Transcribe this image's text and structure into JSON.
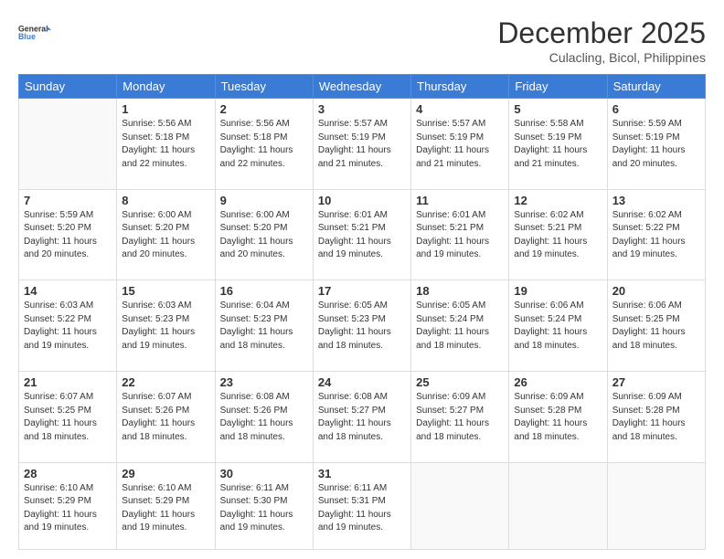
{
  "logo": {
    "line1": "General",
    "line2": "Blue"
  },
  "header": {
    "month_year": "December 2025",
    "location": "Culacling, Bicol, Philippines"
  },
  "weekdays": [
    "Sunday",
    "Monday",
    "Tuesday",
    "Wednesday",
    "Thursday",
    "Friday",
    "Saturday"
  ],
  "weeks": [
    [
      {
        "day": "",
        "info": ""
      },
      {
        "day": "1",
        "info": "Sunrise: 5:56 AM\nSunset: 5:18 PM\nDaylight: 11 hours\nand 22 minutes."
      },
      {
        "day": "2",
        "info": "Sunrise: 5:56 AM\nSunset: 5:18 PM\nDaylight: 11 hours\nand 22 minutes."
      },
      {
        "day": "3",
        "info": "Sunrise: 5:57 AM\nSunset: 5:19 PM\nDaylight: 11 hours\nand 21 minutes."
      },
      {
        "day": "4",
        "info": "Sunrise: 5:57 AM\nSunset: 5:19 PM\nDaylight: 11 hours\nand 21 minutes."
      },
      {
        "day": "5",
        "info": "Sunrise: 5:58 AM\nSunset: 5:19 PM\nDaylight: 11 hours\nand 21 minutes."
      },
      {
        "day": "6",
        "info": "Sunrise: 5:59 AM\nSunset: 5:19 PM\nDaylight: 11 hours\nand 20 minutes."
      }
    ],
    [
      {
        "day": "7",
        "info": "Sunrise: 5:59 AM\nSunset: 5:20 PM\nDaylight: 11 hours\nand 20 minutes."
      },
      {
        "day": "8",
        "info": "Sunrise: 6:00 AM\nSunset: 5:20 PM\nDaylight: 11 hours\nand 20 minutes."
      },
      {
        "day": "9",
        "info": "Sunrise: 6:00 AM\nSunset: 5:20 PM\nDaylight: 11 hours\nand 20 minutes."
      },
      {
        "day": "10",
        "info": "Sunrise: 6:01 AM\nSunset: 5:21 PM\nDaylight: 11 hours\nand 19 minutes."
      },
      {
        "day": "11",
        "info": "Sunrise: 6:01 AM\nSunset: 5:21 PM\nDaylight: 11 hours\nand 19 minutes."
      },
      {
        "day": "12",
        "info": "Sunrise: 6:02 AM\nSunset: 5:21 PM\nDaylight: 11 hours\nand 19 minutes."
      },
      {
        "day": "13",
        "info": "Sunrise: 6:02 AM\nSunset: 5:22 PM\nDaylight: 11 hours\nand 19 minutes."
      }
    ],
    [
      {
        "day": "14",
        "info": "Sunrise: 6:03 AM\nSunset: 5:22 PM\nDaylight: 11 hours\nand 19 minutes."
      },
      {
        "day": "15",
        "info": "Sunrise: 6:03 AM\nSunset: 5:23 PM\nDaylight: 11 hours\nand 19 minutes."
      },
      {
        "day": "16",
        "info": "Sunrise: 6:04 AM\nSunset: 5:23 PM\nDaylight: 11 hours\nand 18 minutes."
      },
      {
        "day": "17",
        "info": "Sunrise: 6:05 AM\nSunset: 5:23 PM\nDaylight: 11 hours\nand 18 minutes."
      },
      {
        "day": "18",
        "info": "Sunrise: 6:05 AM\nSunset: 5:24 PM\nDaylight: 11 hours\nand 18 minutes."
      },
      {
        "day": "19",
        "info": "Sunrise: 6:06 AM\nSunset: 5:24 PM\nDaylight: 11 hours\nand 18 minutes."
      },
      {
        "day": "20",
        "info": "Sunrise: 6:06 AM\nSunset: 5:25 PM\nDaylight: 11 hours\nand 18 minutes."
      }
    ],
    [
      {
        "day": "21",
        "info": "Sunrise: 6:07 AM\nSunset: 5:25 PM\nDaylight: 11 hours\nand 18 minutes."
      },
      {
        "day": "22",
        "info": "Sunrise: 6:07 AM\nSunset: 5:26 PM\nDaylight: 11 hours\nand 18 minutes."
      },
      {
        "day": "23",
        "info": "Sunrise: 6:08 AM\nSunset: 5:26 PM\nDaylight: 11 hours\nand 18 minutes."
      },
      {
        "day": "24",
        "info": "Sunrise: 6:08 AM\nSunset: 5:27 PM\nDaylight: 11 hours\nand 18 minutes."
      },
      {
        "day": "25",
        "info": "Sunrise: 6:09 AM\nSunset: 5:27 PM\nDaylight: 11 hours\nand 18 minutes."
      },
      {
        "day": "26",
        "info": "Sunrise: 6:09 AM\nSunset: 5:28 PM\nDaylight: 11 hours\nand 18 minutes."
      },
      {
        "day": "27",
        "info": "Sunrise: 6:09 AM\nSunset: 5:28 PM\nDaylight: 11 hours\nand 18 minutes."
      }
    ],
    [
      {
        "day": "28",
        "info": "Sunrise: 6:10 AM\nSunset: 5:29 PM\nDaylight: 11 hours\nand 19 minutes."
      },
      {
        "day": "29",
        "info": "Sunrise: 6:10 AM\nSunset: 5:29 PM\nDaylight: 11 hours\nand 19 minutes."
      },
      {
        "day": "30",
        "info": "Sunrise: 6:11 AM\nSunset: 5:30 PM\nDaylight: 11 hours\nand 19 minutes."
      },
      {
        "day": "31",
        "info": "Sunrise: 6:11 AM\nSunset: 5:31 PM\nDaylight: 11 hours\nand 19 minutes."
      },
      {
        "day": "",
        "info": ""
      },
      {
        "day": "",
        "info": ""
      },
      {
        "day": "",
        "info": ""
      }
    ]
  ]
}
